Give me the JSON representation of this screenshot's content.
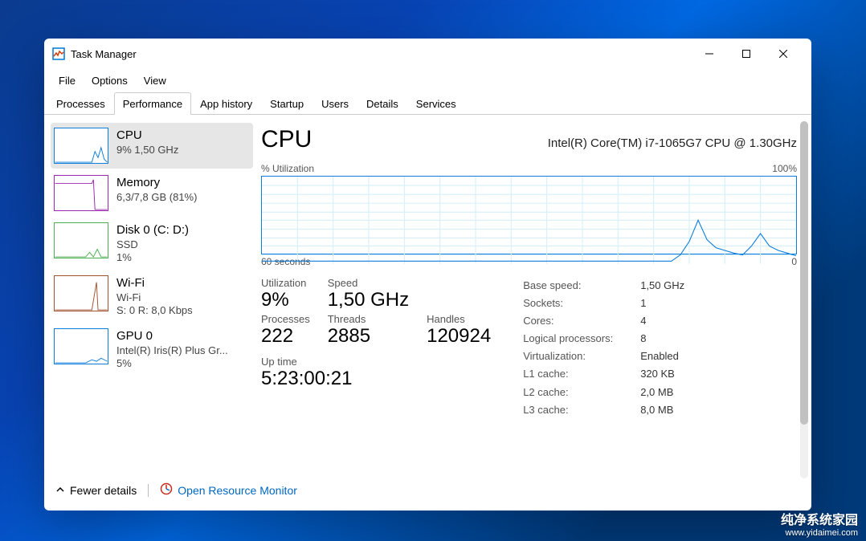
{
  "title": "Task Manager",
  "menus": [
    "File",
    "Options",
    "View"
  ],
  "tabs": [
    "Processes",
    "Performance",
    "App history",
    "Startup",
    "Users",
    "Details",
    "Services"
  ],
  "activeTab": 1,
  "sidebar": [
    {
      "title": "CPU",
      "sub": "9%  1,50 GHz",
      "sub2": "",
      "color": "#0c7ddc"
    },
    {
      "title": "Memory",
      "sub": "6,3/7,8 GB (81%)",
      "sub2": "",
      "color": "#9c27b0"
    },
    {
      "title": "Disk 0 (C: D:)",
      "sub": "SSD",
      "sub2": "1%",
      "color": "#4caf50"
    },
    {
      "title": "Wi-Fi",
      "sub": "Wi-Fi",
      "sub2": "S: 0  R: 8,0 Kbps",
      "color": "#a0522d"
    },
    {
      "title": "GPU 0",
      "sub": "Intel(R) Iris(R) Plus Gr...",
      "sub2": "5%",
      "color": "#0c7ddc"
    }
  ],
  "main": {
    "title": "CPU",
    "spec": "Intel(R) Core(TM) i7-1065G7 CPU @ 1.30GHz",
    "chart": {
      "topLeft": "% Utilization",
      "topRight": "100%",
      "botLeft": "60 seconds",
      "botRight": "0"
    },
    "left": [
      {
        "k": "Utilization",
        "v": "9%"
      },
      {
        "k": "Speed",
        "v": "1,50 GHz"
      },
      {
        "k": "",
        "v": ""
      },
      {
        "k": "Processes",
        "v": "222"
      },
      {
        "k": "Threads",
        "v": "2885"
      },
      {
        "k": "Handles",
        "v": "120924"
      }
    ],
    "uptime": {
      "label": "Up time",
      "value": "5:23:00:21"
    },
    "right": [
      {
        "k": "Base speed:",
        "v": "1,50 GHz"
      },
      {
        "k": "Sockets:",
        "v": "1"
      },
      {
        "k": "Cores:",
        "v": "4"
      },
      {
        "k": "Logical processors:",
        "v": "8"
      },
      {
        "k": "Virtualization:",
        "v": "Enabled"
      },
      {
        "k": "L1 cache:",
        "v": "320 KB"
      },
      {
        "k": "L2 cache:",
        "v": "2,0 MB"
      },
      {
        "k": "L3 cache:",
        "v": "8,0 MB"
      }
    ]
  },
  "bottom": {
    "fewer": "Fewer details",
    "orm": "Open Resource Monitor"
  },
  "watermark": {
    "big": "纯净系统家园",
    "url": "www.yidaimei.com"
  },
  "chart_data": {
    "type": "line",
    "title": "CPU % Utilization",
    "xlabel": "seconds ago",
    "ylabel": "% Utilization",
    "xlim": [
      60,
      0
    ],
    "ylim": [
      0,
      100
    ],
    "x": [
      60,
      14,
      13,
      12,
      11,
      10,
      9,
      8,
      7,
      6,
      5,
      4,
      3,
      2,
      1,
      0
    ],
    "values": [
      3,
      3,
      10,
      25,
      50,
      28,
      18,
      15,
      12,
      10,
      20,
      35,
      20,
      15,
      12,
      9
    ]
  }
}
